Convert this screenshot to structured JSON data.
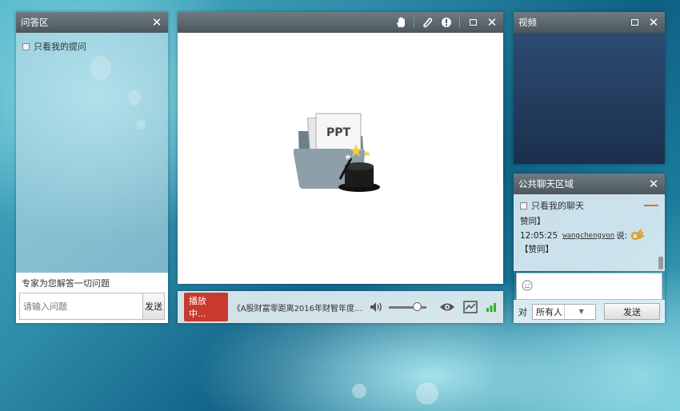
{
  "qa_panel": {
    "title": "问答区",
    "only_mine_label": "只看我的提问",
    "expert_label": "专家为您解答一切问题",
    "input_placeholder": "请输入问题",
    "send_label": "发送"
  },
  "doc_panel": {
    "placeholder_icon": "ppt-magic-hat-icon",
    "ppt_text": "PPT"
  },
  "control_bar": {
    "status": "播放中...",
    "now_playing": "《A股财富零距离2016年财智年度…",
    "volume": 0.75,
    "signal_level": 3,
    "colors": {
      "status": "#c83a2c",
      "signal": "#35b22d"
    }
  },
  "video_panel": {
    "title": "视频"
  },
  "chat_panel": {
    "title": "公共聊天区域",
    "only_mine_label": "只看我的聊天",
    "messages": [
      {
        "text": "赞同】"
      },
      {
        "time": "12:05:25",
        "user": "wangchengyon",
        "said": "说:",
        "emoji": "ok-hand-icon"
      },
      {
        "text": "【赞同】"
      }
    ],
    "to_label": "对",
    "recipient": "所有人",
    "send_label": "发送"
  }
}
